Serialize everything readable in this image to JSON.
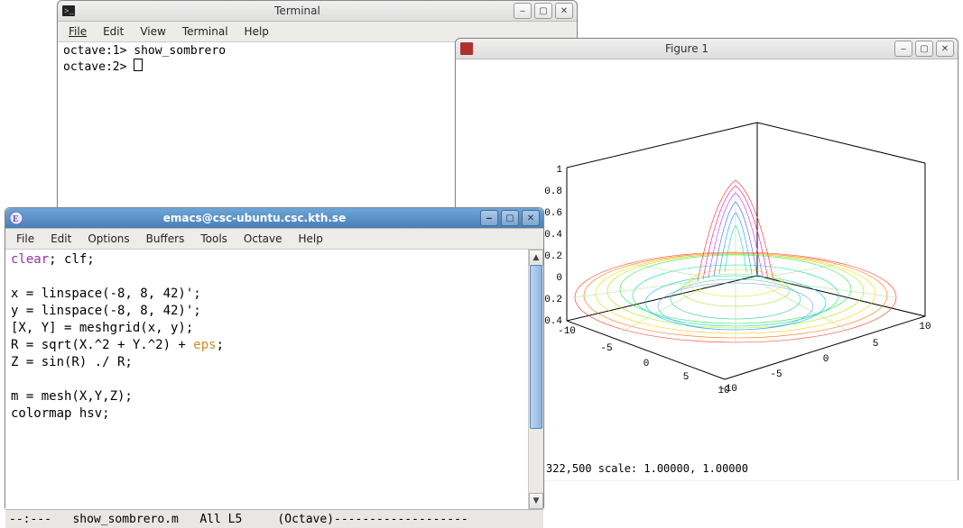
{
  "terminal": {
    "title": "Terminal",
    "menu": [
      "File",
      "Edit",
      "View",
      "Terminal",
      "Help"
    ],
    "lines": {
      "l1_prompt": "octave:1>",
      "l1_cmd": " show_sombrero",
      "l2_prompt": "octave:2>"
    }
  },
  "figure": {
    "title": "Figure 1",
    "status": "322,500   scale: 1.00000, 1.00000",
    "zticks": [
      "1",
      "0.8",
      "0.6",
      "0.4",
      "0.2",
      "0",
      "-0.2",
      "-0.4"
    ],
    "xticks": [
      "-10",
      "-5",
      "0",
      "5",
      "10"
    ],
    "yticks": [
      "-10",
      "-5",
      "0",
      "5",
      "10"
    ]
  },
  "emacs": {
    "title": "emacs@csc-ubuntu.csc.kth.se",
    "menu": [
      "File",
      "Edit",
      "Options",
      "Buffers",
      "Tools",
      "Octave",
      "Help"
    ],
    "code": {
      "clear_kw": "clear",
      "l1_rest": "; clf;",
      "l3": "x = linspace(-8, 8, 42)';",
      "l4": "y = linspace(-8, 8, 42)';",
      "l5": "[X, Y] = meshgrid(x, y);",
      "l6a": "R = sqrt(X.^2 + Y.^2) + ",
      "eps_kw": "eps",
      "l6b": ";",
      "l7": "Z = sin(R) ./ R;",
      "l9": "m = mesh(X,Y,Z);",
      "l10": "colormap hsv;"
    },
    "modeline": "--:---   show_sombrero.m   All L5     (Octave)-------------------"
  },
  "chart_data": {
    "type": "surface",
    "title": "",
    "function": "sin(sqrt(x^2+y^2))/sqrt(x^2+y^2)",
    "x_range": [
      -8,
      8
    ],
    "y_range": [
      -8,
      8
    ],
    "z_range": [
      -0.4,
      1.0
    ],
    "x_ticks": [
      -10,
      -5,
      0,
      5,
      10
    ],
    "y_ticks": [
      -10,
      -5,
      0,
      5,
      10
    ],
    "z_ticks": [
      -0.4,
      -0.2,
      0,
      0.2,
      0.4,
      0.6,
      0.8,
      1
    ],
    "grid_size": 42,
    "colormap": "hsv"
  }
}
